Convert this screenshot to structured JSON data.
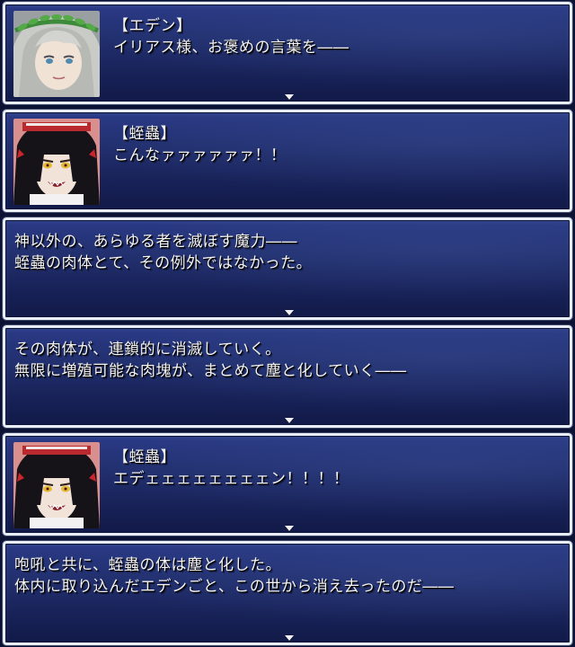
{
  "messages": [
    {
      "speaker": "【エデン】",
      "lines": [
        "イリアス様、お褒めの言葉を――"
      ],
      "portrait_icon": "eden-portrait-icon",
      "continue_arrow": true
    },
    {
      "speaker": "【蛭蟲】",
      "lines": [
        "こんなァァァァァァ！！"
      ],
      "portrait_icon": "hiruchuu-portrait-icon",
      "continue_arrow": false
    },
    {
      "speaker": "",
      "lines": [
        "神以外の、あらゆる者を滅ぼす魔力――",
        "蛭蟲の肉体とて、その例外ではなかった。"
      ],
      "portrait_icon": "",
      "continue_arrow": true
    },
    {
      "speaker": "",
      "lines": [
        "その肉体が、連鎖的に消滅していく。",
        "無限に増殖可能な肉塊が、まとめて塵と化していく――"
      ],
      "portrait_icon": "",
      "continue_arrow": true
    },
    {
      "speaker": "【蛭蟲】",
      "lines": [
        "エデェェェェェェェェン！！！！"
      ],
      "portrait_icon": "hiruchuu-portrait-icon",
      "continue_arrow": true
    },
    {
      "speaker": "",
      "lines": [
        "咆吼と共に、蛭蟲の体は塵と化した。",
        "体内に取り込んだエデンごと、この世から消え去ったのだ――"
      ],
      "portrait_icon": "",
      "continue_arrow": true
    }
  ],
  "colors": {
    "window_top": "#2a3a86",
    "window_bottom": "#111a48",
    "window_border": "#e8ecf4",
    "text": "#f4f4f6"
  }
}
